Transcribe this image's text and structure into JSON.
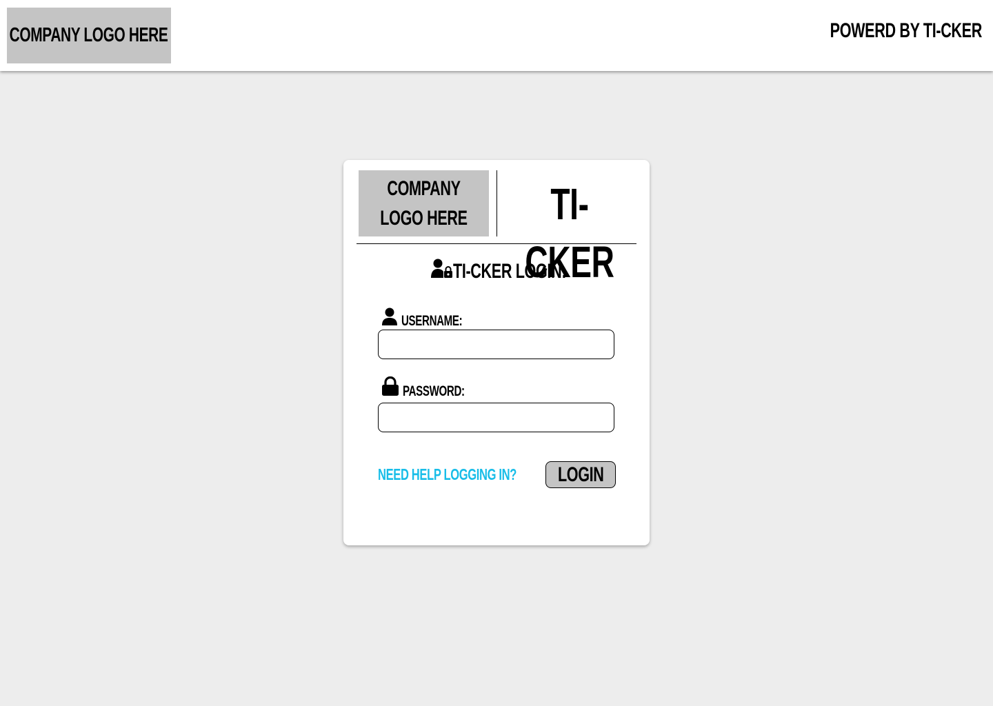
{
  "header": {
    "logo_text": "COMPANY LOGO HERE",
    "powered_by": "POWERD BY TI-CKER"
  },
  "card": {
    "logo_text": "COMPANY LOGO HERE",
    "brand_name": "TI-CKER",
    "login_title": "TI-CKER LOGIN:",
    "username_label": "USERNAME:",
    "username_value": "",
    "password_label": "PASSWORD:",
    "password_value": "",
    "help_link": "NEED HELP LOGGING IN?",
    "login_button": "LOGIN"
  },
  "colors": {
    "background": "#ededed",
    "placeholder_gray": "#c4c4c4",
    "link_cyan": "#18bde8",
    "text": "#000000"
  },
  "icons": {
    "title_icon": "user-lock-icon",
    "username_icon": "user-icon",
    "password_icon": "lock-icon"
  }
}
